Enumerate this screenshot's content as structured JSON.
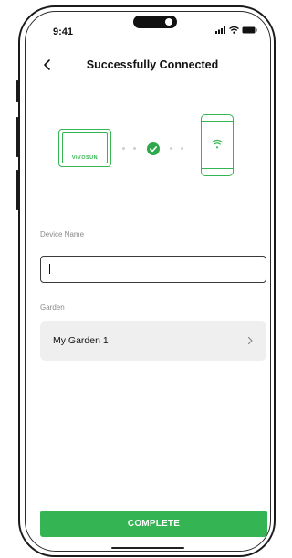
{
  "status_bar": {
    "time": "9:41"
  },
  "header": {
    "title": "Successfully Connected"
  },
  "illustration": {
    "device_brand": "VIVOSUN"
  },
  "device_name": {
    "label": "Device Name",
    "value": "",
    "cursor": "I"
  },
  "garden": {
    "label": "Garden",
    "selected": "My Garden 1"
  },
  "actions": {
    "complete_label": "COMPLETE"
  },
  "colors": {
    "accent": "#34b453",
    "row_bg": "#efefef",
    "label_gray": "#8a8a8a"
  }
}
